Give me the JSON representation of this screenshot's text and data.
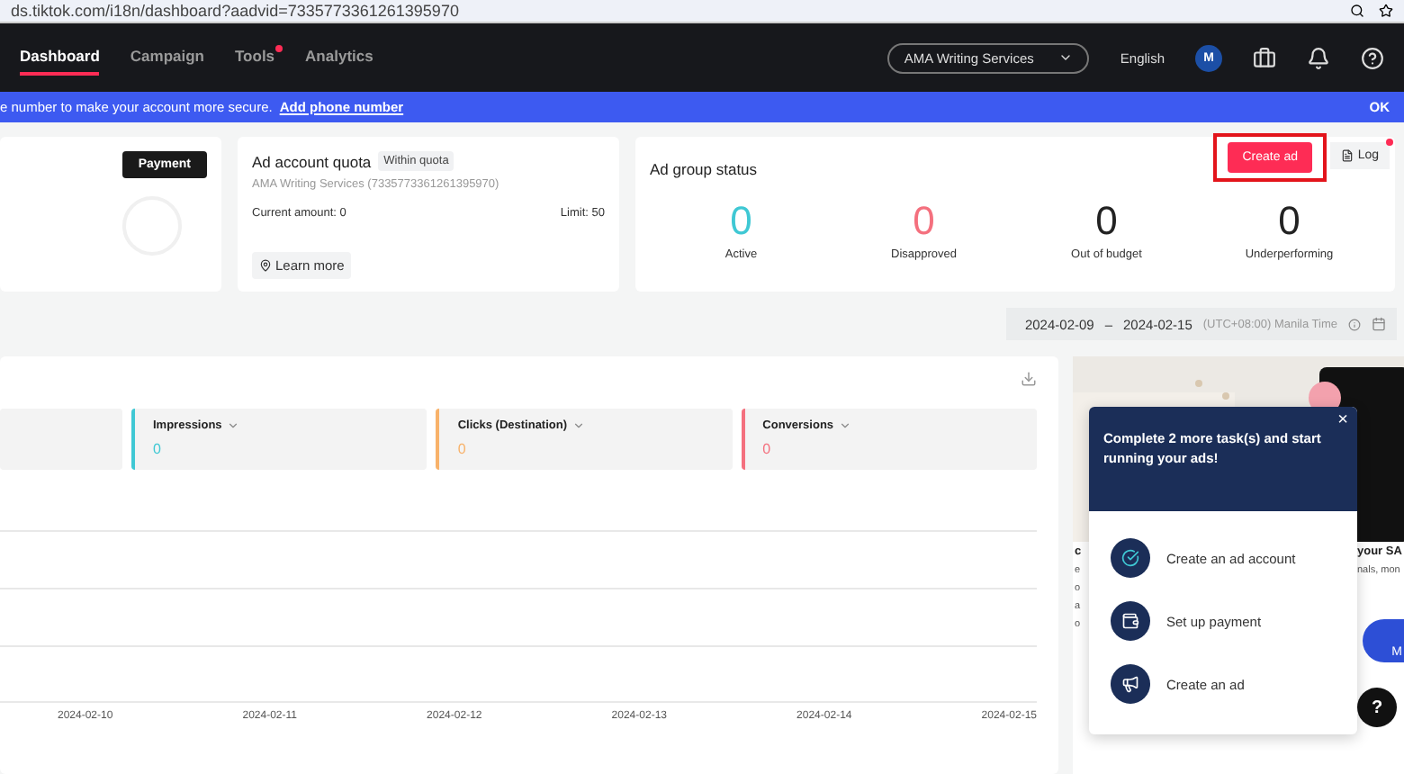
{
  "browser": {
    "url": "ds.tiktok.com/i18n/dashboard?aadvid=7335773361261395970"
  },
  "nav": {
    "tabs": [
      {
        "label": "Dashboard",
        "selected": true,
        "dot": false
      },
      {
        "label": "Campaign",
        "selected": false,
        "dot": false
      },
      {
        "label": "Tools",
        "selected": false,
        "dot": true
      },
      {
        "label": "Analytics",
        "selected": false,
        "dot": false
      }
    ],
    "account": "AMA Writing Services",
    "language": "English",
    "avatar": "M"
  },
  "banner": {
    "text": "e number to make your account more secure.",
    "link": "Add phone number",
    "ok": "OK"
  },
  "payment_card": {
    "button": "Payment"
  },
  "quota_card": {
    "title": "Ad account quota",
    "tag": "Within quota",
    "account": "AMA Writing Services (7335773361261395970)",
    "current": "Current amount: 0",
    "limit": "Limit: 50",
    "link": "Learn more"
  },
  "status_card": {
    "title": "Ad group status",
    "create_button": "Create ad",
    "log_button": "Log",
    "log_dot": true,
    "stats": [
      {
        "value": "0",
        "label": "Active",
        "color": "#3fc8d4"
      },
      {
        "value": "0",
        "label": "Disapproved",
        "color": "#f4707e"
      },
      {
        "value": "0",
        "label": "Out of budget",
        "color": "#222222"
      },
      {
        "value": "0",
        "label": "Underperforming",
        "color": "#222222"
      }
    ]
  },
  "date_range": {
    "start": "2024-02-09",
    "separator": "–",
    "end": "2024-02-15",
    "timezone": "(UTC+08:00) Manila Time"
  },
  "metrics": [
    {
      "label": "Impressions",
      "value": "0",
      "color": "#3fc8d4"
    },
    {
      "label": "Clicks (Destination)",
      "value": "0",
      "color": "#f8b26a"
    },
    {
      "label": "Conversions",
      "value": "0",
      "color": "#f4707e"
    }
  ],
  "chart": {
    "x_labels": [
      "2024-02-10",
      "2024-02-11",
      "2024-02-12",
      "2024-02-13",
      "2024-02-14",
      "2024-02-15"
    ]
  },
  "side_cards": [
    {
      "title": "c",
      "lines": [
        "e",
        "o",
        "a",
        "o"
      ]
    },
    {
      "title": "your SA",
      "lines": [
        "nals, mon"
      ]
    }
  ],
  "tasks_popup": {
    "title": "Complete 2 more task(s) and start running your ads!",
    "close": "×",
    "tasks": [
      {
        "kind": "account",
        "label": "Create an ad account",
        "done": true
      },
      {
        "kind": "payment",
        "label": "Set up payment",
        "done": false
      },
      {
        "kind": "ad",
        "label": "Create an ad",
        "done": false
      }
    ]
  },
  "help_button": "?",
  "compass_badge": "M"
}
